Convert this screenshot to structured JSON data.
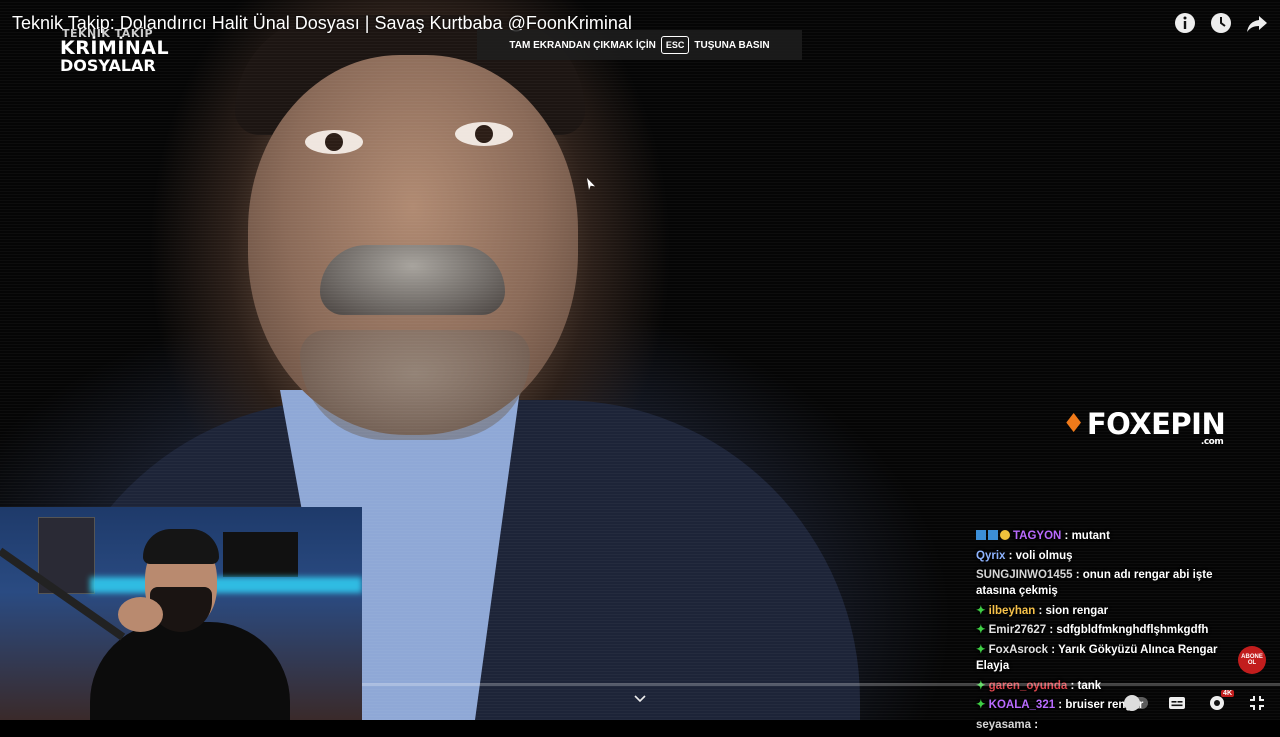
{
  "video": {
    "title": "Teknik Takip: Dolandırıcı Halit Ünal Dosyası | Savaş Kurtbaba @FoonKriminal",
    "logo": {
      "line1": "TEKNİK TAKİP",
      "line2": "KRİMİNAL",
      "line3": "DOSYALAR"
    },
    "sponsor": {
      "brand": "FOXEPIN",
      "domain": ".com",
      "accent_color": "#f07a1a"
    }
  },
  "fullscreen_banner": {
    "prefix": "TAM EKRANDAN ÇIKMAK İÇİN",
    "key": "ESC",
    "suffix": "TUŞUNA BASIN"
  },
  "top_icons": [
    "info-icon",
    "watch-later-icon",
    "share-icon"
  ],
  "chat": {
    "messages": [
      {
        "user": "TAGYON",
        "text": "mutant",
        "color": "#b96bff",
        "badges": [
          "prime",
          "gift",
          "coin"
        ]
      },
      {
        "user": "Qyrix",
        "text": "voli olmuş",
        "color": "#8fb4ff",
        "badges": []
      },
      {
        "user": "SUNGJINWO1455",
        "text": "onun adı rengar abi işte atasına çekmiş",
        "color": "#d6d6d6",
        "badges": []
      },
      {
        "user": "ilbeyhan",
        "text": "sion rengar",
        "color": "#f5c14a",
        "badges": [
          "star"
        ]
      },
      {
        "user": "Emir27627",
        "text": "sdfgbldfmknghdflşhmkgdfh",
        "color": "#e3e3e3",
        "badges": [
          "star"
        ]
      },
      {
        "user": "FoxAsrock",
        "text": "Yarık Gökyüzü Alınca Rengar Elayja",
        "color": "#e3e3e3",
        "badges": [
          "star"
        ]
      },
      {
        "user": "garen_oyunda",
        "text": "tank",
        "color": "#e0474f",
        "badges": [
          "star"
        ]
      },
      {
        "user": "KOALA_321",
        "text": "bruiser rengar",
        "color": "#b96bff",
        "badges": [
          "star"
        ]
      },
      {
        "user": "seyasama",
        "text": "",
        "color": "#d6d6d6",
        "badges": []
      }
    ],
    "separator": " : "
  },
  "subscribe_badge": {
    "line1": "ABONE",
    "line2": "OL"
  },
  "controls": {
    "quality_badge": "4K",
    "icons": [
      "autoplay-toggle",
      "subtitles-icon",
      "settings-icon",
      "exit-fullscreen-icon"
    ]
  }
}
